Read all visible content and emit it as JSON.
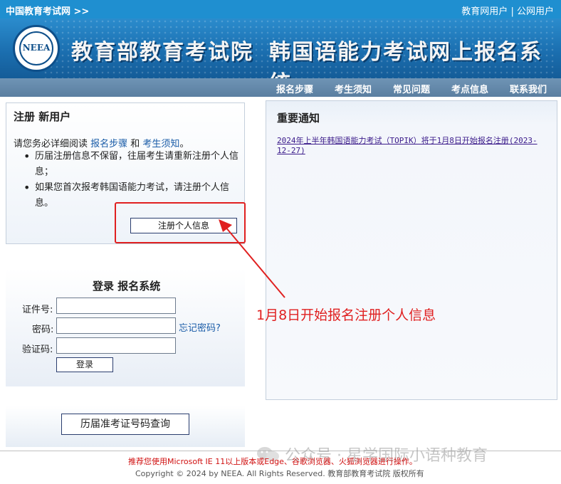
{
  "topbar": {
    "site": "中国教育考试网 >>",
    "edu_user": "教育网用户",
    "sep": "|",
    "public_user": "公网用户"
  },
  "banner": {
    "logo_text": "NEEA",
    "org": "教育部教育考试院",
    "system": "韩国语能力考试网上报名系统"
  },
  "nav": [
    "报名步骤",
    "考生须知",
    "常见问题",
    "考点信息",
    "联系我们"
  ],
  "register": {
    "title": "注册 新用户",
    "intro_prefix": "请您务必详细阅读 ",
    "link_steps": "报名步骤",
    "intro_and": " 和 ",
    "link_notice": "考生须知",
    "intro_suffix": "。",
    "bullets": [
      "历届注册信息不保留，往届考生请重新注册个人信息；",
      "如果您首次报考韩国语能力考试，请注册个人信息。"
    ],
    "button": "注册个人信息"
  },
  "notice": {
    "title": "重要通知",
    "items": [
      "2024年上半年韩国语能力考试（TOPIK）将于1月8日开始报名注册(2023-12-27)"
    ]
  },
  "login": {
    "title": "登录 报名系统",
    "id_label": "证件号:",
    "pwd_label": "密码:",
    "code_label": "验证码:",
    "forgot": "忘记密码?",
    "button": "登录"
  },
  "history": {
    "button": "历届准考证号码查询"
  },
  "annotation": {
    "text": "1月8日开始报名注册个人信息",
    "color": "#e02020"
  },
  "footer": {
    "recommend": "推荐您使用Microsoft IE 11以上版本或Edge、谷歌浏览器、火狐浏览器进行操作。",
    "copyright": "Copyright © 2024 by NEEA. All Rights Reserved. 教育部教育考试院 版权所有"
  },
  "watermark": {
    "text": "公众号 · 星学国际小语种教育"
  },
  "colors": {
    "topbar": "#1f8fd0",
    "nav": "#6f94b5",
    "accent_red": "#e02020",
    "link": "#1a5ca8"
  }
}
